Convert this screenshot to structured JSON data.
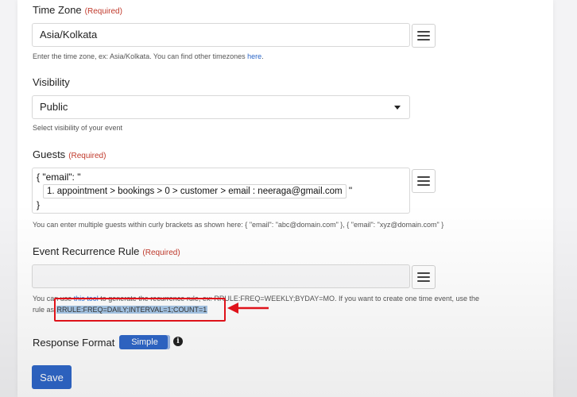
{
  "timezone": {
    "label": "Time Zone",
    "required": "(Required)",
    "value": "Asia/Kolkata",
    "help": "Enter the time zone, ex: Asia/Kolkata. You can find other timezones ",
    "help_link": "here",
    "help_end": "."
  },
  "visibility": {
    "label": "Visibility",
    "value": "Public",
    "help": "Select visibility of your event"
  },
  "guests": {
    "label": "Guests",
    "required": "(Required)",
    "line1": "{ \"email\": \"",
    "token": "1. appointment > bookings > 0 > customer > email : neeraga@gmail.com",
    "quote": "\"",
    "line3": "}",
    "help": "You can enter multiple guests within curly brackets as shown here: { \"email\": \"abc@domain.com\" }, { \"email\": \"xyz@domain.com\" }"
  },
  "recurrence": {
    "label": "Event Recurrence Rule",
    "required": "(Required)",
    "value": "",
    "help_pre": "You can use ",
    "help_link": "this tool",
    "help_mid": " to generate the recurrence rule, ex: RRULE:FREQ=WEEKLY;BYDAY=MO. If you want to create one time event, use the",
    "help_line2_pre": "rule as ",
    "help_highlight": "RRULE:FREQ=DAILY;INTERVAL=1;COUNT=1"
  },
  "response_format": {
    "label": "Response Format",
    "toggle_value": "Simple",
    "info_glyph": "i"
  },
  "save_label": "Save",
  "colors": {
    "accent": "#2f67c9",
    "required": "#c0392b",
    "annotation": "#e8131b",
    "highlight": "#a7c7e7"
  }
}
